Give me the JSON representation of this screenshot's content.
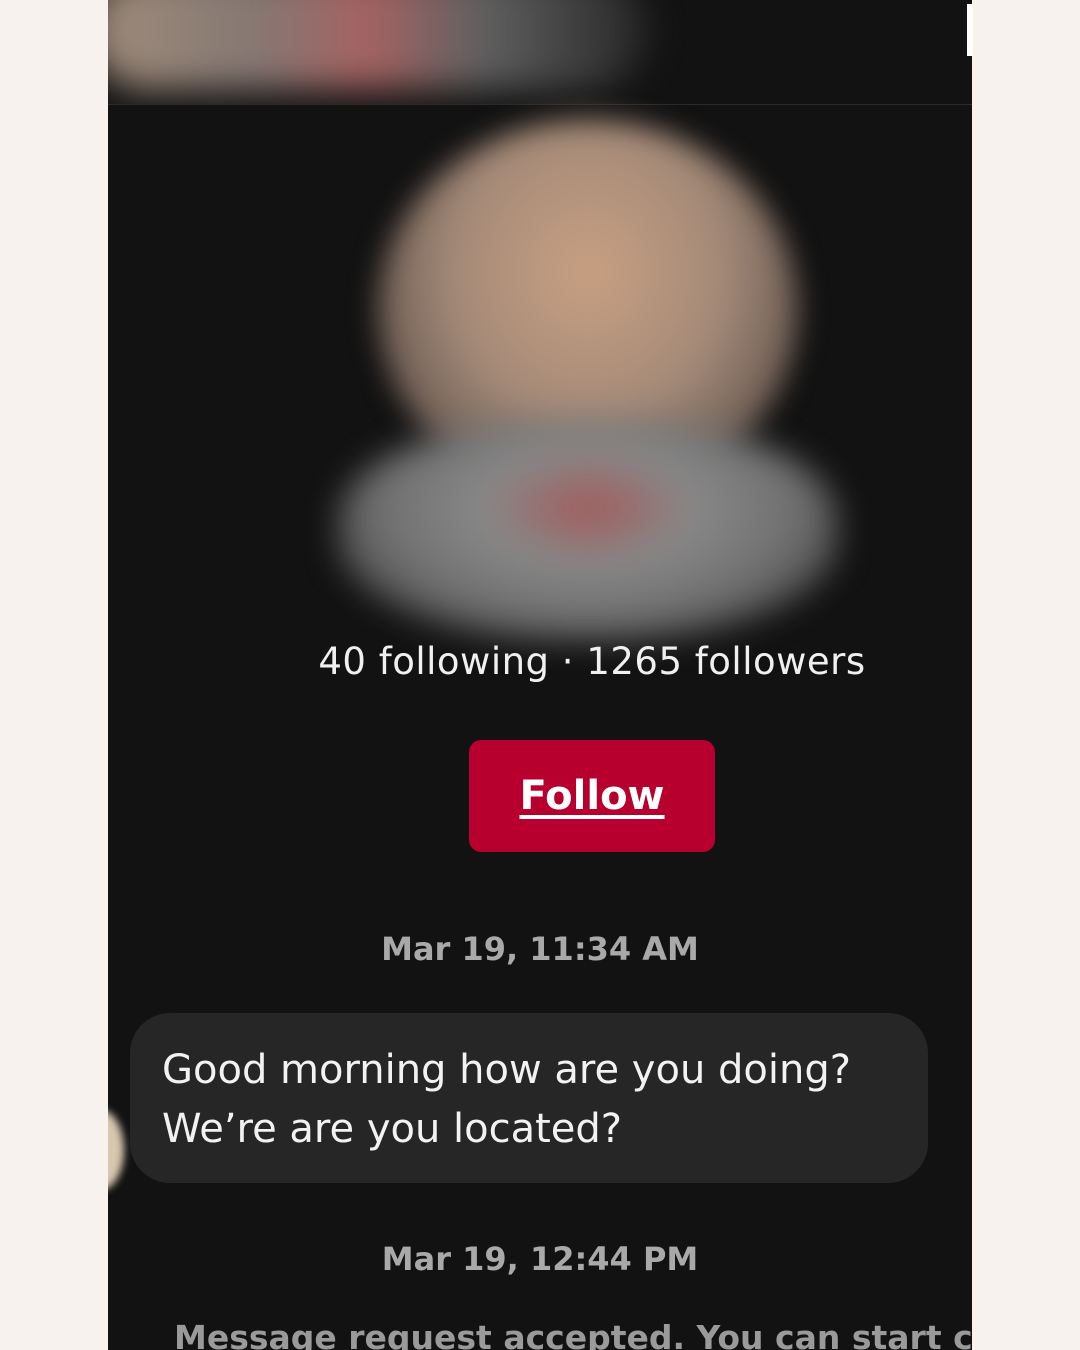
{
  "profile": {
    "following_count": "40",
    "following_label": "following",
    "separator": "·",
    "followers_count": "1265",
    "followers_label": "followers",
    "stats_text": "40 following · 1265 followers"
  },
  "follow_button": {
    "label": "Follow",
    "color": "#b8002e"
  },
  "conversation": {
    "messages": [
      {
        "timestamp": "Mar 19, 11:34 AM",
        "lines": [
          "Good morning how are you doing?",
          "We’re are you located?"
        ]
      }
    ],
    "second_timestamp": "Mar 19, 12:44 PM",
    "system_note": "Message request accepted. You can start chattin"
  },
  "theme": {
    "background": "#121212",
    "bubble": "#262626",
    "page_margin": "#f7f2ee"
  }
}
